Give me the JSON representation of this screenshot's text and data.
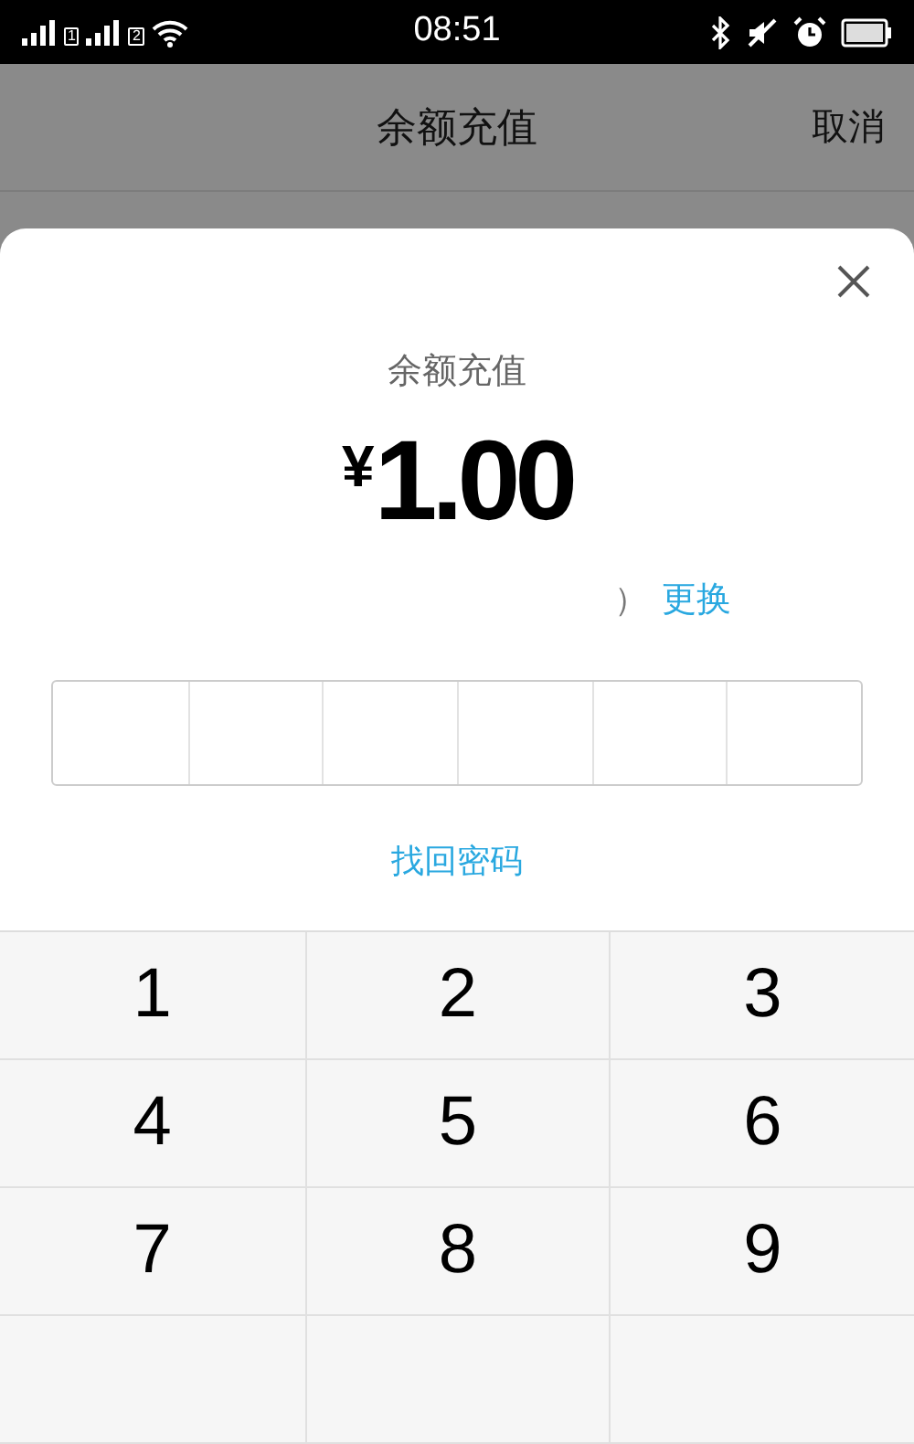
{
  "status_bar": {
    "sim_labels": [
      "1",
      "2"
    ],
    "time": "08:51"
  },
  "header": {
    "title": "余额充值",
    "cancel": "取消"
  },
  "sheet": {
    "title": "余额充值",
    "currency": "¥",
    "amount": "1.00",
    "method_tail": "）",
    "change_link": "更换",
    "forgot_link": "找回密码"
  },
  "keypad": {
    "keys": [
      {
        "label": "1"
      },
      {
        "label": "2"
      },
      {
        "label": "3"
      },
      {
        "label": "4"
      },
      {
        "label": "5"
      },
      {
        "label": "6"
      },
      {
        "label": "7"
      },
      {
        "label": "8"
      },
      {
        "label": "9"
      }
    ]
  }
}
